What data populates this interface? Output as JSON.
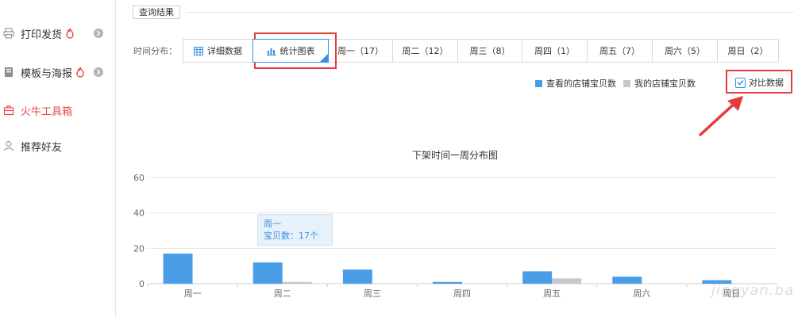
{
  "sidebar": {
    "items": [
      {
        "label": "打印发货",
        "icon": "printer-icon",
        "hot": true,
        "chevron": true,
        "active": false
      },
      {
        "label": "模板与海报",
        "icon": "template-icon",
        "hot": true,
        "chevron": true,
        "active": false
      },
      {
        "label": "火牛工具箱",
        "icon": "toolbox-icon",
        "hot": false,
        "chevron": false,
        "active": true
      },
      {
        "label": "推荐好友",
        "icon": "user-icon",
        "hot": false,
        "chevron": false,
        "active": false
      }
    ]
  },
  "main": {
    "section_title": "查询结果",
    "filter_label": "时间分布：",
    "tabs": [
      {
        "label": "详细数据",
        "icon": "table-icon"
      },
      {
        "label": "统计图表",
        "icon": "bar-chart-icon",
        "selected": true
      },
      {
        "label": "周一（17）"
      },
      {
        "label": "周二（12）"
      },
      {
        "label": "周三（8）"
      },
      {
        "label": "周四（1）"
      },
      {
        "label": "周五（7）"
      },
      {
        "label": "周六（5）"
      },
      {
        "label": "周日（2）"
      }
    ],
    "legend": [
      {
        "label": "查看的店铺宝贝数",
        "color": "#4a9ee8"
      },
      {
        "label": "我的店铺宝贝数",
        "color": "#c8c8c8"
      }
    ],
    "compare_label": "对比数据",
    "compare_checked": true,
    "tooltip": {
      "line1": "周一",
      "line2": "宝贝数：17个"
    },
    "watermark": "jingyan.baidu.com"
  },
  "chart_data": {
    "type": "bar",
    "title": "下架时间一周分布图",
    "categories": [
      "周一",
      "周二",
      "周三",
      "周四",
      "周五",
      "周六",
      "周日"
    ],
    "series": [
      {
        "name": "查看的店铺宝贝数",
        "color": "#4a9ee8",
        "values": [
          17,
          12,
          8,
          1,
          7,
          4,
          2
        ]
      },
      {
        "name": "我的店铺宝贝数",
        "color": "#c8c8c8",
        "values": [
          0,
          1,
          0,
          0,
          3,
          0,
          0
        ]
      }
    ],
    "yticks": [
      0,
      20,
      40,
      60
    ],
    "ylim": [
      0,
      60
    ],
    "grid": true
  },
  "colors": {
    "accent": "#3a8ee6",
    "active": "#e8474c",
    "highlight": "#e8393b"
  }
}
